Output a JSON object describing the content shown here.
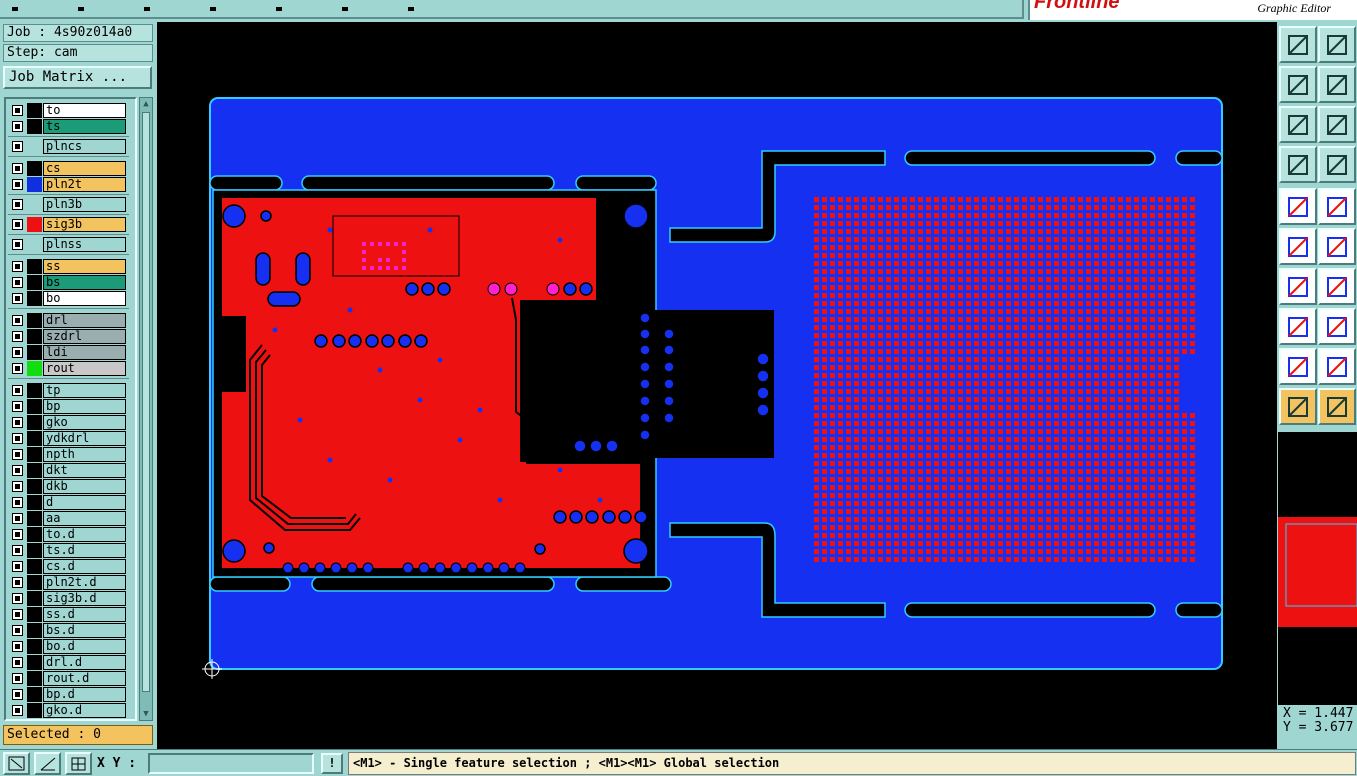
{
  "brand": {
    "logo": "Frontline",
    "subtitle": "Graphic Editor"
  },
  "job": {
    "job_line": "Job : 4s90z014a0",
    "step_line": "Step: cam",
    "matrix_button": "Job Matrix ..."
  },
  "layers": [
    {
      "name": "to",
      "color": "#ffffff",
      "swatch": "#000000"
    },
    {
      "name": "ts",
      "color": "#1b9b78",
      "swatch": "#000000"
    },
    {
      "name": "plncs",
      "color": "#9fd6d2",
      "swatch": "#9fd6d2"
    },
    {
      "name": "cs",
      "color": "#f2c35f",
      "swatch": "#000000"
    },
    {
      "name": "pln2t",
      "color": "#f2c35f",
      "swatch": "#1030e0"
    },
    {
      "name": "pln3b",
      "color": "#9fd6d2",
      "swatch": "#9fd6d2"
    },
    {
      "name": "sig3b",
      "color": "#f2c35f",
      "swatch": "#ee1111"
    },
    {
      "name": "plnss",
      "color": "#9fd6d2",
      "swatch": "#9fd6d2"
    },
    {
      "name": "ss",
      "color": "#f2c35f",
      "swatch": "#000000"
    },
    {
      "name": "bs",
      "color": "#1b9b78",
      "swatch": "#000000"
    },
    {
      "name": "bo",
      "color": "#ffffff",
      "swatch": "#000000"
    },
    {
      "name": "drl",
      "color": "#9aaeb0",
      "swatch": "#000000"
    },
    {
      "name": "szdrl",
      "color": "#9aaeb0",
      "swatch": "#000000"
    },
    {
      "name": "ldi",
      "color": "#9aaeb0",
      "swatch": "#000000"
    },
    {
      "name": "rout",
      "color": "#c8c8c8",
      "swatch": "#11dd11"
    },
    {
      "name": "tp",
      "color": "#9fd6d2",
      "swatch": "#000000"
    },
    {
      "name": "bp",
      "color": "#9fd6d2",
      "swatch": "#000000"
    },
    {
      "name": "gko",
      "color": "#9fd6d2",
      "swatch": "#000000"
    },
    {
      "name": "ydkdrl",
      "color": "#9fd6d2",
      "swatch": "#000000"
    },
    {
      "name": "npth",
      "color": "#9fd6d2",
      "swatch": "#000000"
    },
    {
      "name": "dkt",
      "color": "#9fd6d2",
      "swatch": "#000000"
    },
    {
      "name": "dkb",
      "color": "#9fd6d2",
      "swatch": "#000000"
    },
    {
      "name": "d",
      "color": "#9fd6d2",
      "swatch": "#000000"
    },
    {
      "name": "aa",
      "color": "#9fd6d2",
      "swatch": "#000000"
    },
    {
      "name": "to.d",
      "color": "#9fd6d2",
      "swatch": "#000000"
    },
    {
      "name": "ts.d",
      "color": "#9fd6d2",
      "swatch": "#000000"
    },
    {
      "name": "cs.d",
      "color": "#9fd6d2",
      "swatch": "#000000"
    },
    {
      "name": "pln2t.d",
      "color": "#9fd6d2",
      "swatch": "#000000"
    },
    {
      "name": "sig3b.d",
      "color": "#9fd6d2",
      "swatch": "#000000"
    },
    {
      "name": "ss.d",
      "color": "#9fd6d2",
      "swatch": "#000000"
    },
    {
      "name": "bs.d",
      "color": "#9fd6d2",
      "swatch": "#000000"
    },
    {
      "name": "bo.d",
      "color": "#9fd6d2",
      "swatch": "#000000"
    },
    {
      "name": "drl.d",
      "color": "#9fd6d2",
      "swatch": "#000000"
    },
    {
      "name": "rout.d",
      "color": "#9fd6d2",
      "swatch": "#000000"
    },
    {
      "name": "bp.d",
      "color": "#9fd6d2",
      "swatch": "#000000"
    },
    {
      "name": "gko.d",
      "color": "#9fd6d2",
      "swatch": "#000000"
    }
  ],
  "selected": "Selected : 0",
  "coords": {
    "x": "X = 1.447",
    "y": "Y = 3.677"
  },
  "bottom": {
    "xy_label": "X Y :",
    "xy_value": "",
    "warn": "!",
    "status": "<M1> - Single feature selection ; <M1><M1> Global selection"
  },
  "colors": {
    "panel": "#9fd6d2",
    "board": "#1530f0",
    "copper": "#ee1111",
    "outline": "#33ccff",
    "highlight": "#f2c35f",
    "pad_magenta": "#ff22cc"
  },
  "icons": {
    "toolbar": [
      "zoom-page-up-icon",
      "zoom-page-down-icon",
      "zoom-left-icon",
      "zoom-right-icon",
      "zoom-fit-icon",
      "zoom-center-icon",
      "settings-icon",
      "grid-icon",
      "snap-icon",
      "measure-icon",
      "connect-icon",
      "cross-icon",
      "angle-icon",
      "line-icon",
      "copy-icon",
      "minus-icon",
      "triangle-icon",
      "triangle-select-icon",
      "pointer-icon",
      "pointer-active-icon"
    ],
    "bottom": [
      "zoom-box-icon",
      "line-angle-icon",
      "snap-grid-icon"
    ]
  }
}
